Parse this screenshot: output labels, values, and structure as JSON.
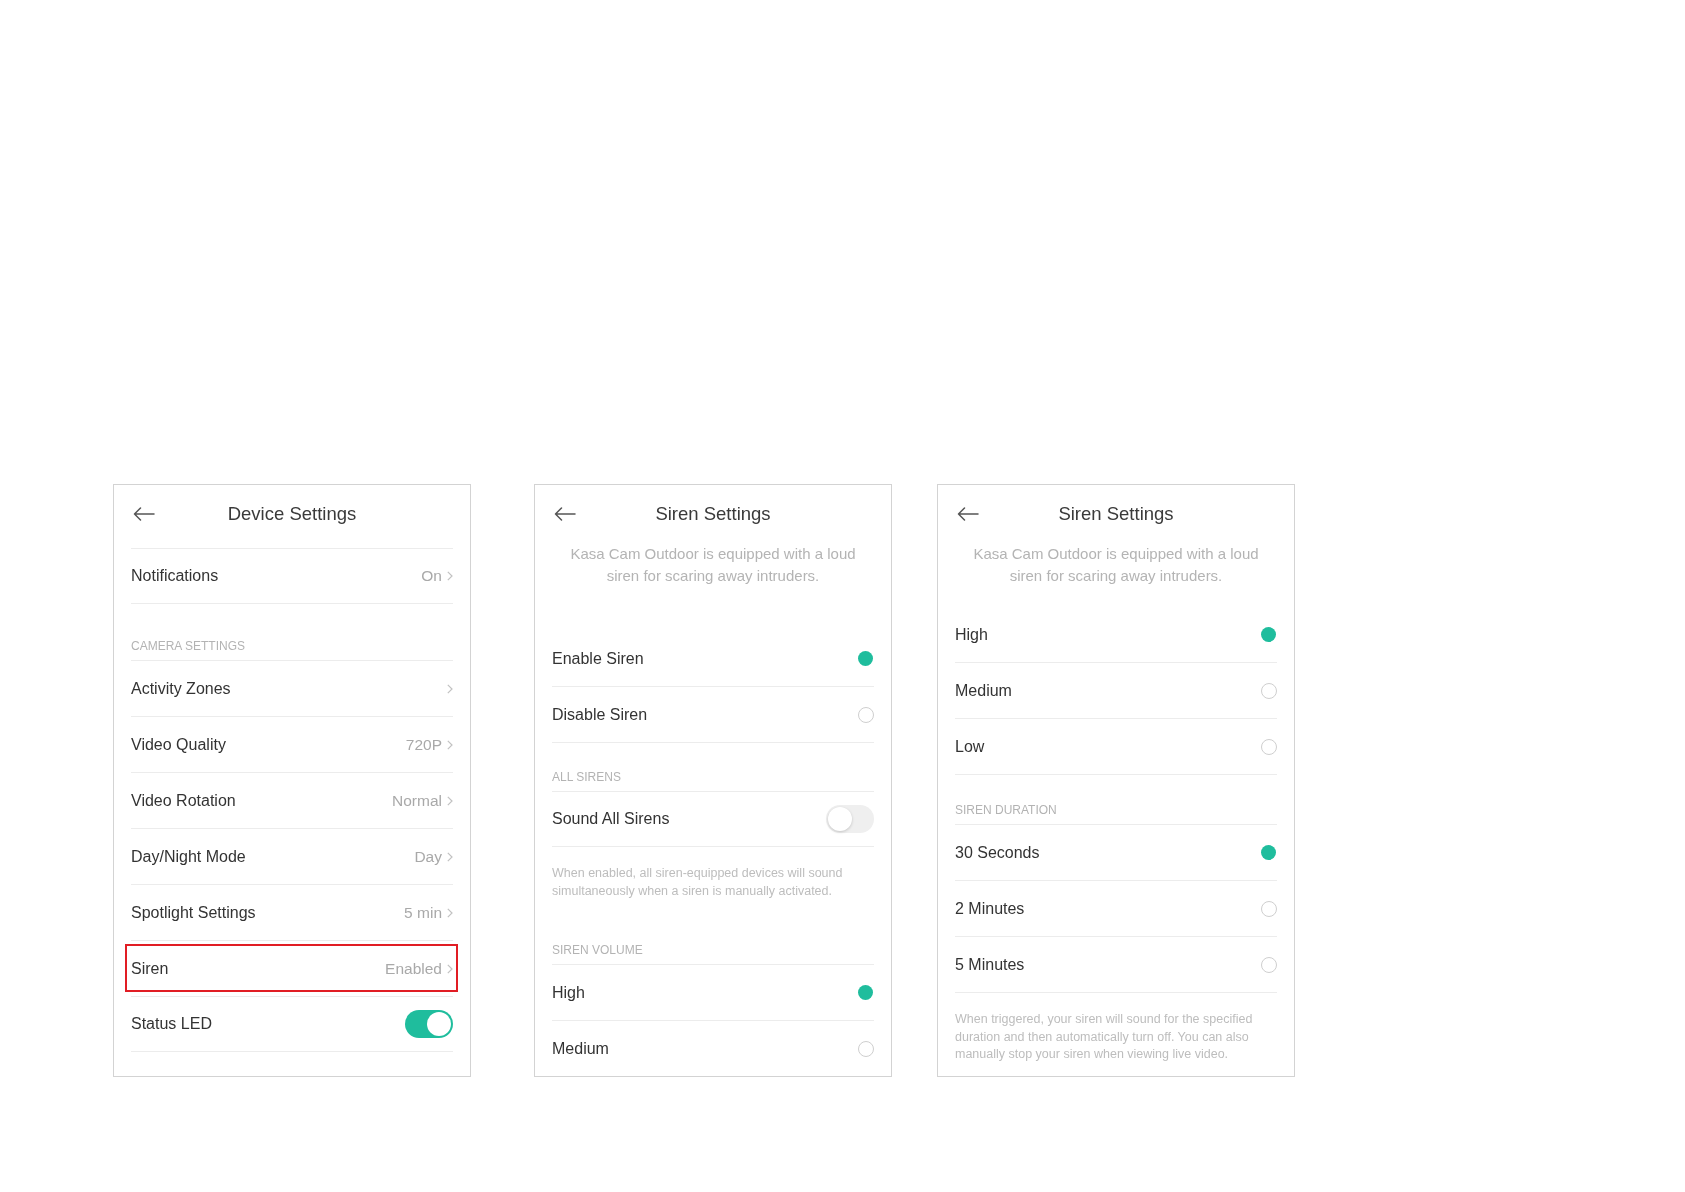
{
  "screens": [
    {
      "title": "Device Settings",
      "items": [
        {
          "kind": "nav",
          "label": "Notifications",
          "value": "On",
          "highlighted": false
        },
        {
          "kind": "section",
          "label": "CAMERA SETTINGS"
        },
        {
          "kind": "nav",
          "label": "Activity Zones",
          "highlighted": false
        },
        {
          "kind": "nav",
          "label": "Video Quality",
          "value": "720P",
          "highlighted": false
        },
        {
          "kind": "nav",
          "label": "Video Rotation",
          "value": "Normal",
          "highlighted": false
        },
        {
          "kind": "nav",
          "label": "Day/Night Mode",
          "value": "Day",
          "highlighted": false
        },
        {
          "kind": "nav",
          "label": "Spotlight Settings",
          "value": "5 min",
          "highlighted": false
        },
        {
          "kind": "nav",
          "label": "Siren",
          "value": "Enabled",
          "highlighted": true
        },
        {
          "kind": "toggle",
          "label": "Status LED",
          "on": true
        }
      ]
    },
    {
      "title": "Siren Settings",
      "description": "Kasa Cam Outdoor is equipped with a loud siren for scaring away intruders.",
      "items": [
        {
          "kind": "radio",
          "label": "Enable Siren",
          "selected": true
        },
        {
          "kind": "radio",
          "label": "Disable Siren",
          "selected": false
        },
        {
          "kind": "section",
          "label": "ALL SIRENS"
        },
        {
          "kind": "toggle",
          "label": "Sound All Sirens",
          "on": false
        },
        {
          "kind": "note",
          "text": "When enabled, all siren-equipped devices will sound simultaneously when a siren is manually activated."
        },
        {
          "kind": "section",
          "label": "SIREN VOLUME"
        },
        {
          "kind": "radio",
          "label": "High",
          "selected": true
        },
        {
          "kind": "radio",
          "label": "Medium",
          "selected": false
        }
      ]
    },
    {
      "title": "Siren Settings",
      "description": "Kasa Cam Outdoor is equipped with a loud siren for scaring away intruders.",
      "items": [
        {
          "kind": "radio",
          "label": "High",
          "selected": true
        },
        {
          "kind": "radio",
          "label": "Medium",
          "selected": false
        },
        {
          "kind": "radio",
          "label": "Low",
          "selected": false
        },
        {
          "kind": "section",
          "label": "SIREN DURATION"
        },
        {
          "kind": "radio",
          "label": "30 Seconds",
          "selected": true
        },
        {
          "kind": "radio",
          "label": "2 Minutes",
          "selected": false
        },
        {
          "kind": "radio",
          "label": "5 Minutes",
          "selected": false
        },
        {
          "kind": "note",
          "text": "When triggered, your siren will sound for the specified duration and then automatically turn off. You can also manually stop your siren when viewing live video."
        }
      ]
    }
  ]
}
